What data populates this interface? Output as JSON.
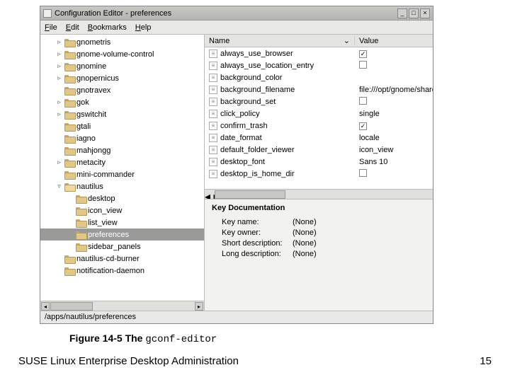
{
  "window": {
    "title": "Configuration Editor - preferences",
    "buttons": {
      "min": "_",
      "max": "□",
      "close": "×"
    }
  },
  "menubar": {
    "file": "File",
    "edit": "Edit",
    "bookmarks": "Bookmarks",
    "help": "Help"
  },
  "tree": {
    "items": [
      {
        "indent": 1,
        "twist": "▹",
        "label": "gnometris"
      },
      {
        "indent": 1,
        "twist": "▹",
        "label": "gnome-volume-control"
      },
      {
        "indent": 1,
        "twist": "▹",
        "label": "gnomine"
      },
      {
        "indent": 1,
        "twist": "▹",
        "label": "gnopernicus"
      },
      {
        "indent": 1,
        "twist": "",
        "label": "gnotravex"
      },
      {
        "indent": 1,
        "twist": "▹",
        "label": "gok"
      },
      {
        "indent": 1,
        "twist": "▹",
        "label": "gswitchit"
      },
      {
        "indent": 1,
        "twist": "",
        "label": "gtali"
      },
      {
        "indent": 1,
        "twist": "",
        "label": "iagno"
      },
      {
        "indent": 1,
        "twist": "",
        "label": "mahjongg"
      },
      {
        "indent": 1,
        "twist": "▹",
        "label": "metacity"
      },
      {
        "indent": 1,
        "twist": "",
        "label": "mini-commander"
      },
      {
        "indent": 1,
        "twist": "▿",
        "label": "nautilus",
        "open": true
      },
      {
        "indent": 2,
        "twist": "",
        "label": "desktop"
      },
      {
        "indent": 2,
        "twist": "",
        "label": "icon_view"
      },
      {
        "indent": 2,
        "twist": "",
        "label": "list_view"
      },
      {
        "indent": 2,
        "twist": "",
        "label": "preferences",
        "selected": true
      },
      {
        "indent": 2,
        "twist": "",
        "label": "sidebar_panels"
      },
      {
        "indent": 1,
        "twist": "",
        "label": "nautilus-cd-burner"
      },
      {
        "indent": 1,
        "twist": "",
        "label": "notification-daemon"
      }
    ]
  },
  "table": {
    "head_name": "Name",
    "head_value": "Value",
    "rows": [
      {
        "key": "always_use_browser",
        "val_type": "check",
        "checked": true
      },
      {
        "key": "always_use_location_entry",
        "val_type": "check",
        "checked": false
      },
      {
        "key": "background_color",
        "val_type": "text",
        "value": ""
      },
      {
        "key": "background_filename",
        "val_type": "text",
        "value": "file:///opt/gnome/share/nauti"
      },
      {
        "key": "background_set",
        "val_type": "check",
        "checked": false
      },
      {
        "key": "click_policy",
        "val_type": "text",
        "value": "single"
      },
      {
        "key": "confirm_trash",
        "val_type": "check",
        "checked": true
      },
      {
        "key": "date_format",
        "val_type": "text",
        "value": "locale"
      },
      {
        "key": "default_folder_viewer",
        "val_type": "text",
        "value": "icon_view"
      },
      {
        "key": "desktop_font",
        "val_type": "text",
        "value": "Sans 10"
      },
      {
        "key": "desktop_is_home_dir",
        "val_type": "check",
        "checked": false
      }
    ]
  },
  "doc": {
    "title": "Key Documentation",
    "rows": {
      "key_name_label": "Key name:",
      "key_name_value": "(None)",
      "key_owner_label": "Key owner:",
      "key_owner_value": "(None)",
      "short_label": "Short description:",
      "short_value": "(None)",
      "long_label": "Long description:",
      "long_value": "(None)"
    }
  },
  "statusbar": "/apps/nautilus/preferences",
  "caption": {
    "prefix": "Figure 14-5 The ",
    "mono": "gconf-editor"
  },
  "footer": {
    "left": "SUSE Linux Enterprise Desktop Administration",
    "right": "15"
  }
}
